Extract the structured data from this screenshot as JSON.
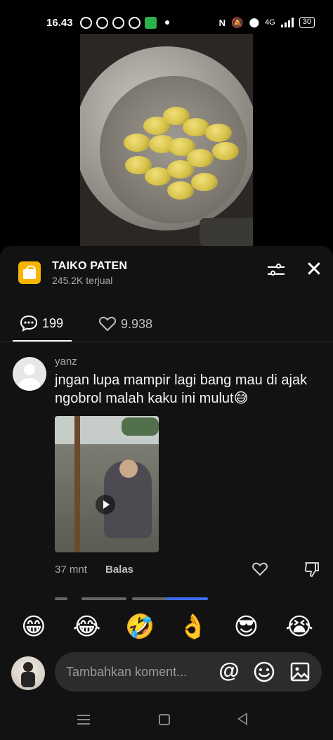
{
  "status_bar": {
    "time": "16.43",
    "network_type": "4G",
    "battery": "30"
  },
  "video": {
    "description_icon": "cooking-pot-video-thumbnail"
  },
  "shop": {
    "name": "TAIKO PATEN",
    "sold": "245.2K terjual",
    "icon": "shopping-bag-icon",
    "accent_color": "#f7b500"
  },
  "tabs": {
    "comments_count": "199",
    "likes_count": "9.938"
  },
  "comment": {
    "username": "yanz",
    "text": "jngan lupa mampir lagi bang mau di ajak ngobrol malah kaku ini mulut😅",
    "time": "37 mnt",
    "reply_label": "Balas"
  },
  "emoji_bar": [
    "😁",
    "😂",
    "🤣",
    "👌",
    "😎",
    "😭"
  ],
  "input": {
    "placeholder": "Tambahkan koment..."
  }
}
